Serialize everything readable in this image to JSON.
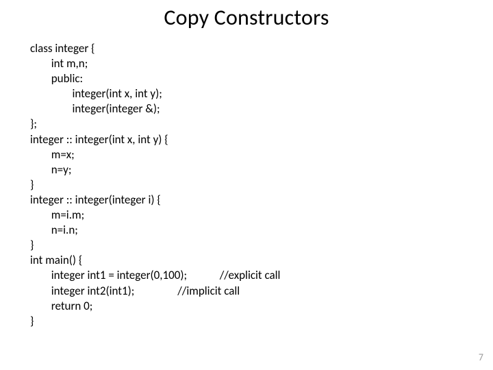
{
  "title": "Copy Constructors",
  "code": {
    "l01": "class integer {",
    "l02": "\tint m,n;",
    "l03": "\tpublic:",
    "l04": "\t\tinteger(int x, int y);",
    "l05": "\t\tinteger(integer &);",
    "l06": "};",
    "l07": "integer :: integer(int x, int y) {",
    "l08": "\tm=x;",
    "l09": "\tn=y;",
    "l10": "}",
    "l11": "integer :: integer(integer i) {",
    "l12": "\tm=i.m;",
    "l13": "\tn=i.n;",
    "l14": "}",
    "l15": "int main() {",
    "l16": "\tinteger int1 = integer(0,100);\t\t//explicit call",
    "l17": "\tinteger int2(int1);\t\t//implicit call",
    "l18": "\treturn 0;",
    "l19": "}"
  },
  "page_number": "7"
}
